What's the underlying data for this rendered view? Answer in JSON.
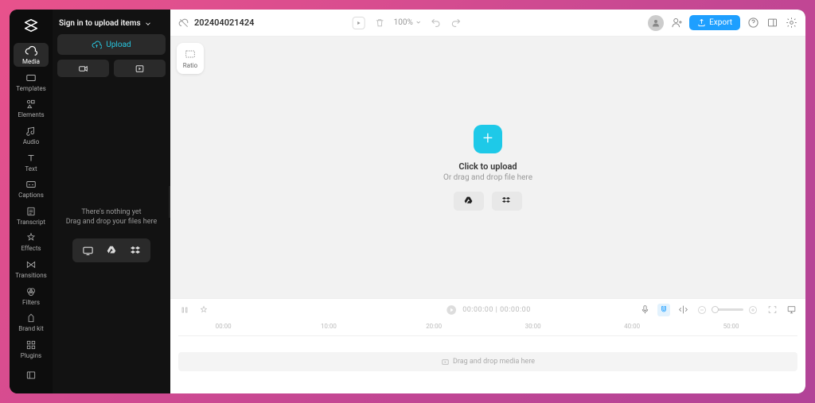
{
  "signin_label": "Sign in to upload items",
  "nav": [
    {
      "id": "media",
      "label": "Media"
    },
    {
      "id": "templates",
      "label": "Templates"
    },
    {
      "id": "elements",
      "label": "Elements"
    },
    {
      "id": "audio",
      "label": "Audio"
    },
    {
      "id": "text",
      "label": "Text"
    },
    {
      "id": "captions",
      "label": "Captions"
    },
    {
      "id": "transcript",
      "label": "Transcript"
    },
    {
      "id": "effects",
      "label": "Effects"
    },
    {
      "id": "transitions",
      "label": "Transitions"
    },
    {
      "id": "filters",
      "label": "Filters"
    },
    {
      "id": "brandkit",
      "label": "Brand kit"
    },
    {
      "id": "plugins",
      "label": "Plugins"
    }
  ],
  "upload_button": "Upload",
  "drop_line1": "There's nothing yet",
  "drop_line2": "Drag and drop your files here",
  "project_name": "202404021424",
  "zoom": "100%",
  "export_label": "Export",
  "ratio_label": "Ratio",
  "stage_title": "Click to upload",
  "stage_sub": "Or drag and drop file here",
  "timecode_current": "00:00:00",
  "timecode_total": "00:00:00",
  "ruler_ticks": [
    "00:00",
    "10:00",
    "20:00",
    "30:00",
    "40:00",
    "50:00"
  ],
  "track_placeholder": "Drag and drop media here",
  "colors": {
    "accent": "#1e9fff",
    "cyan": "#1ec9e8"
  }
}
